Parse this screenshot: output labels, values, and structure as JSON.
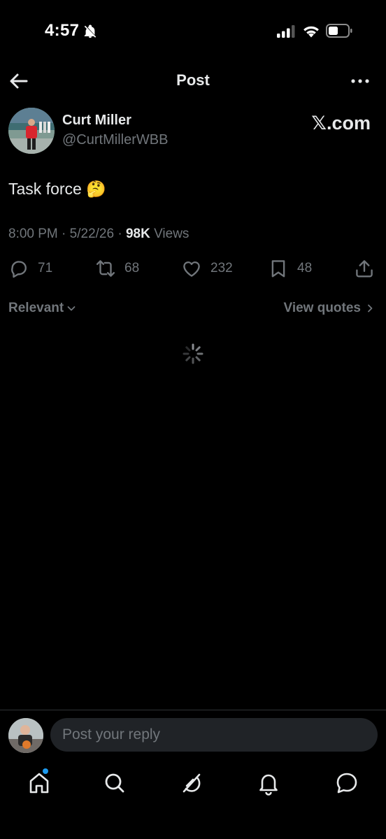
{
  "status_bar": {
    "time": "4:57",
    "icons": [
      "bell-off-icon",
      "signal-icon",
      "wifi-icon",
      "battery-icon"
    ]
  },
  "header": {
    "title": "Post",
    "back_icon": "arrow-left-icon",
    "more_icon": "more-horizontal-icon"
  },
  "post": {
    "author": {
      "name": "Curt Miller",
      "handle": "@CurtMillerWBB"
    },
    "source_badge": "𝕏.com",
    "text": "Task force 🤔",
    "meta": {
      "time": "8:00 PM",
      "date": "5/22/26",
      "views_count": "98K",
      "views_label": "Views"
    },
    "actions": {
      "replies": "71",
      "reposts": "68",
      "likes": "232",
      "bookmarks": "48"
    }
  },
  "replies_filter": {
    "sort_label": "Relevant",
    "quotes_label": "View quotes"
  },
  "reply_composer": {
    "placeholder": "Post your reply"
  },
  "bottom_nav": {
    "items": [
      "home-icon",
      "search-icon",
      "grok-icon",
      "notifications-icon",
      "messages-icon"
    ]
  },
  "colors": {
    "background": "#000000",
    "text_primary": "#e7e9ea",
    "text_secondary": "#71767b",
    "accent": "#1d9bf0",
    "input_bg": "#202327"
  }
}
